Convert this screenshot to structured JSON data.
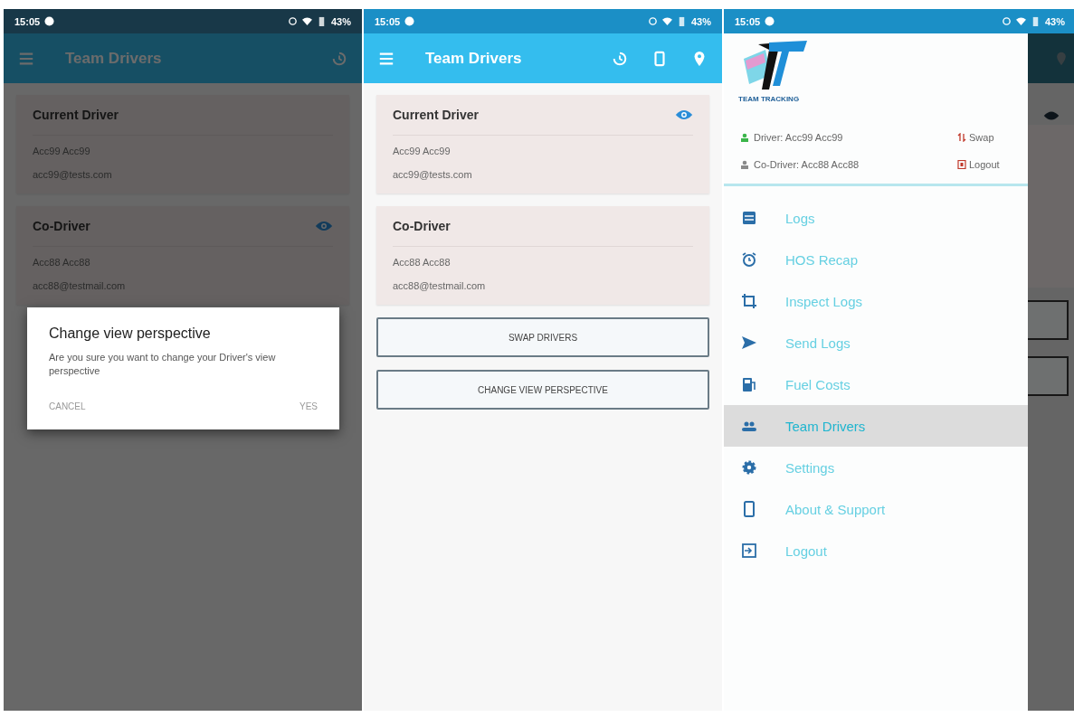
{
  "screens": [
    {
      "kind": "dialog",
      "status_bar": {
        "time": "15:05",
        "battery": "43%"
      },
      "toolbar": {
        "title": "Team Drivers"
      },
      "cards": [
        {
          "title": "Current Driver",
          "name": "Acc99 Acc99",
          "email": "acc99@tests.com",
          "eye": false
        },
        {
          "title": "Co-Driver",
          "name": "Acc88 Acc88",
          "email": "acc88@testmail.com",
          "eye": true
        }
      ],
      "dialog": {
        "title": "Change view perspective",
        "message": "Are you sure you want to change your Driver's view perspective",
        "buttons": [
          "CANCEL",
          "YES"
        ]
      }
    },
    {
      "kind": "main",
      "status_bar": {
        "time": "15:05",
        "battery": "43%"
      },
      "toolbar": {
        "title": "Team Drivers"
      },
      "cards": [
        {
          "title": "Current Driver",
          "name": "Acc99 Acc99",
          "email": "acc99@tests.com",
          "eye": true
        },
        {
          "title": "Co-Driver",
          "name": "Acc88 Acc88",
          "email": "acc88@testmail.com",
          "eye": false
        }
      ],
      "buttons": [
        "SWAP DRIVERS",
        "CHANGE VIEW PERSPECTIVE"
      ]
    },
    {
      "kind": "drawer",
      "status_bar": {
        "time": "15:05",
        "battery": "43%"
      },
      "drawer": {
        "logo_text": "TEAM TRACKING",
        "driver": "Driver: Acc99 Acc99",
        "co_driver": "Co-Driver: Acc88 Acc88",
        "swap": "Swap",
        "logout": "Logout",
        "items": [
          {
            "label": "Logs",
            "selected": false
          },
          {
            "label": "HOS Recap",
            "selected": false
          },
          {
            "label": "Inspect Logs",
            "selected": false
          },
          {
            "label": "Send Logs",
            "selected": false
          },
          {
            "label": "Fuel Costs",
            "selected": false
          },
          {
            "label": "Team Drivers",
            "selected": true
          },
          {
            "label": "Settings",
            "selected": false
          },
          {
            "label": "About & Support",
            "selected": false
          },
          {
            "label": "Logout",
            "selected": false
          }
        ]
      }
    }
  ]
}
